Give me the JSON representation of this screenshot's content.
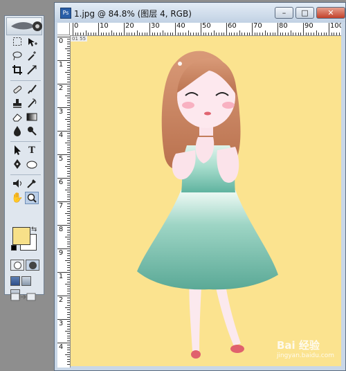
{
  "window": {
    "title": "1.jpg @ 84.8% (图层 4, RGB)",
    "minimize_label": "–",
    "maximize_label": "□",
    "close_label": "✕"
  },
  "rulers": {
    "horizontal": [
      "0",
      "10",
      "20",
      "30",
      "40",
      "50",
      "60",
      "70",
      "80",
      "90",
      "100"
    ],
    "vertical": [
      "0",
      "1",
      "2",
      "3",
      "4",
      "5",
      "6",
      "7",
      "8",
      "9",
      "1",
      "2",
      "3",
      "4"
    ]
  },
  "canvas": {
    "background": "#fbe38f",
    "doc_tag": "01 55"
  },
  "toolbox": {
    "foreground_color": "#f7e089",
    "background_color": "#ffffff",
    "tools": [
      "marquee-tool",
      "move-tool",
      "lasso-tool",
      "magic-wand-tool",
      "crop-tool",
      "slice-tool",
      "healing-brush-tool",
      "brush-tool",
      "clone-stamp-tool",
      "history-brush-tool",
      "eraser-tool",
      "gradient-tool",
      "blur-tool",
      "dodge-tool",
      "path-selection-tool",
      "type-tool",
      "pen-tool",
      "shape-tool",
      "notes-tool",
      "eyedropper-tool",
      "hand-tool",
      "zoom-tool"
    ],
    "selected_tool": "zoom-tool"
  },
  "watermark": {
    "text": "Bai 经验",
    "sub": "jingyan.baidu.com"
  }
}
